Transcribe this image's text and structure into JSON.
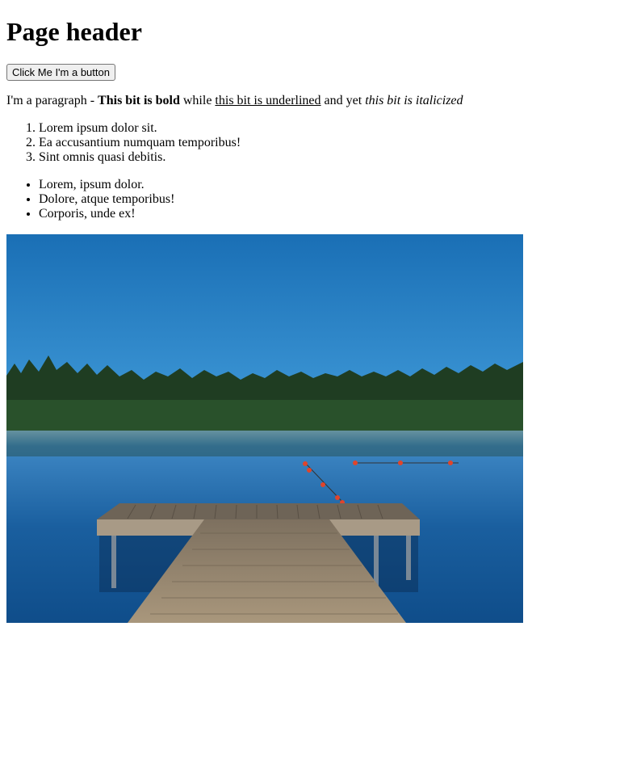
{
  "page": {
    "header": "Page header",
    "button_label": "Click Me I'm a button",
    "paragraph": {
      "lead": "I'm a paragraph - ",
      "bold": "This bit is bold",
      "mid1": " while ",
      "underline": "this bit is underlined",
      "mid2": " and yet ",
      "italic": "this bit is italicized"
    },
    "ordered_list": [
      "Lorem ipsum dolor sit.",
      "Ea accusantium numquam temporibus!",
      "Sint omnis quasi debitis."
    ],
    "unordered_list": [
      "Lorem, ipsum dolor.",
      "Dolore, atque temporibus!",
      "Corporis, unde ex!"
    ]
  },
  "colors": {
    "sky_top": "#1f7fc4",
    "sky_bottom": "#8fc4e8",
    "water": "#1565a8",
    "trees": "#1f3d22",
    "dock": "#9a8a72",
    "buoy": "#e0452b"
  }
}
